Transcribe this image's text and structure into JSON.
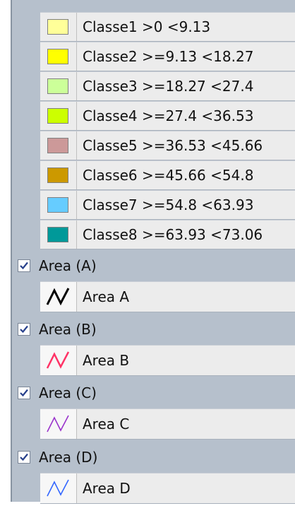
{
  "classes": [
    {
      "label": "Classe1 >0 <9.13",
      "color": "#ffff99"
    },
    {
      "label": "Classe2 >=9.13 <18.27",
      "color": "#ffff00"
    },
    {
      "label": "Classe3 >=18.27 <27.4",
      "color": "#ccff99"
    },
    {
      "label": "Classe4 >=27.4 <36.53",
      "color": "#ccff00"
    },
    {
      "label": "Classe5 >=36.53 <45.66",
      "color": "#cc9999"
    },
    {
      "label": "Classe6 >=45.66 <54.8",
      "color": "#cc9900"
    },
    {
      "label": "Classe7 >=54.8 <63.93",
      "color": "#66ccff"
    },
    {
      "label": "Classe8 >=63.93 <73.06",
      "color": "#009999"
    }
  ],
  "groups": [
    {
      "header": "Area (A)",
      "checked": true,
      "item": "Area A",
      "line_color": "#000000",
      "icon": "line-symbol-icon"
    },
    {
      "header": "Area (B)",
      "checked": true,
      "item": "Area B",
      "line_color": "#ff3366",
      "icon": "line-symbol-icon"
    },
    {
      "header": "Area (C)",
      "checked": true,
      "item": "Area C",
      "line_color": "#9933cc",
      "icon": "line-symbol-icon"
    },
    {
      "header": "Area (D)",
      "checked": true,
      "item": "Area D",
      "line_color": "#3366ff",
      "icon": "line-symbol-icon"
    }
  ]
}
